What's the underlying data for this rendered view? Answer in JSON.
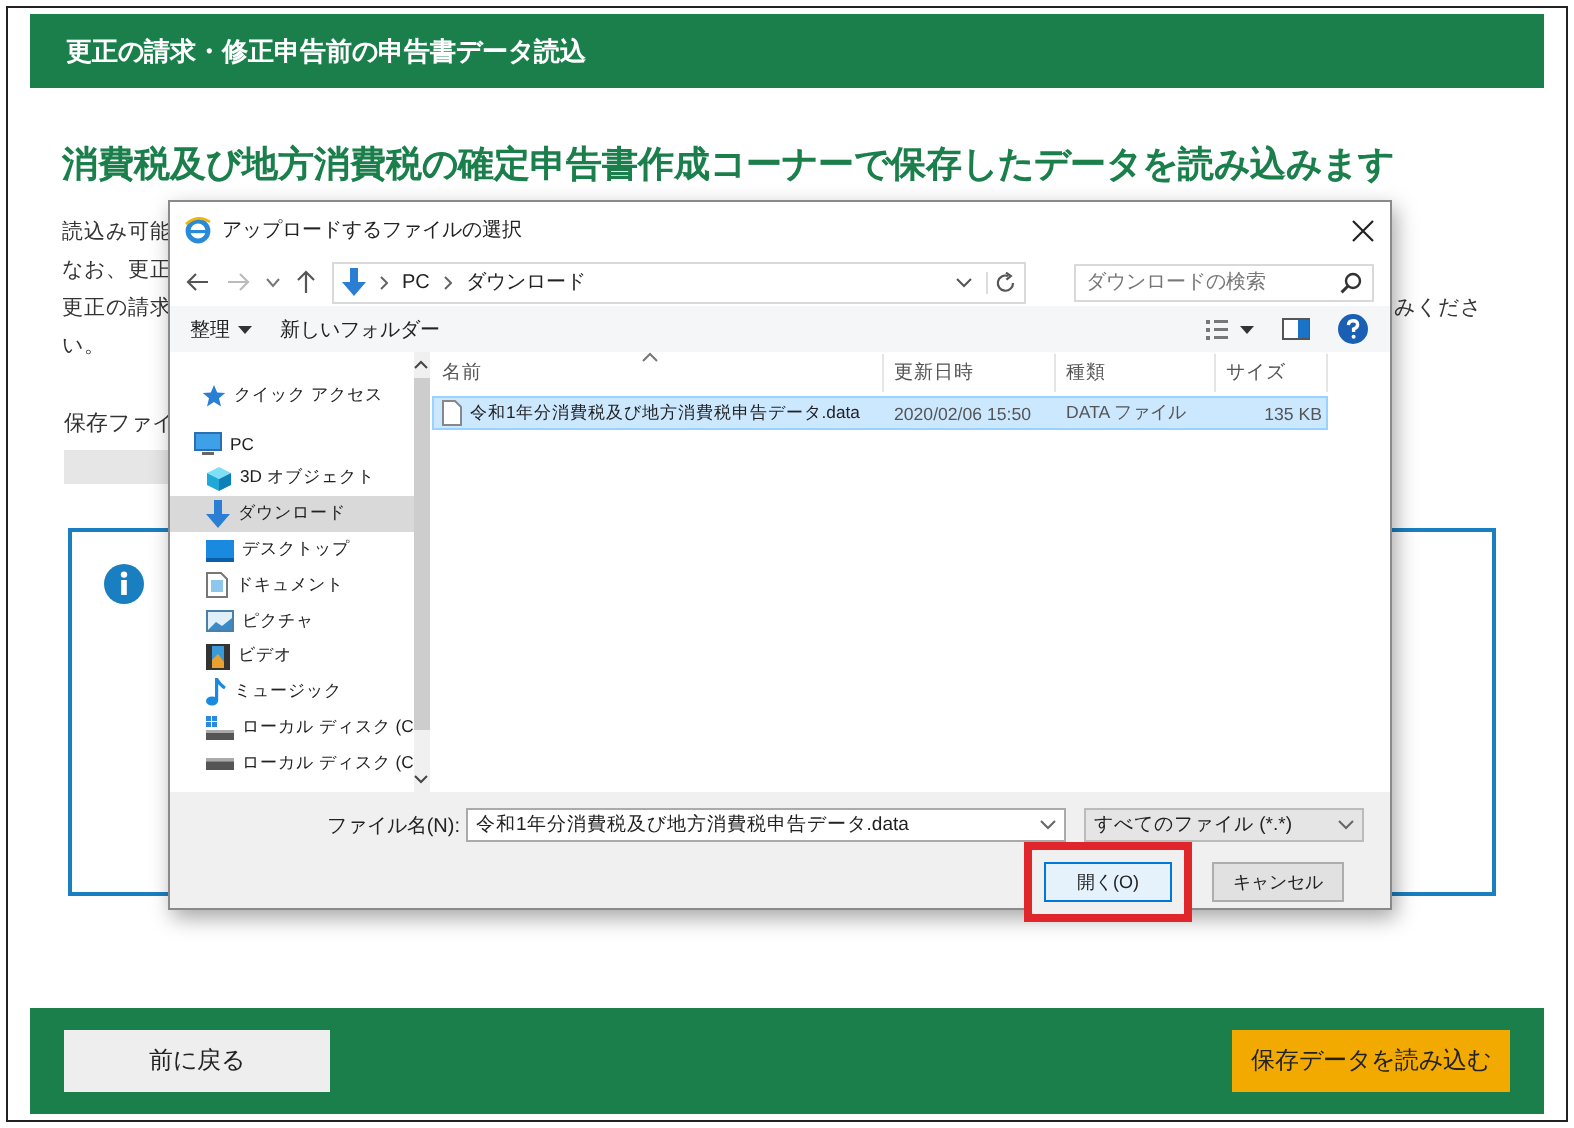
{
  "header": {
    "title": "更正の請求・修正申告前の申告書データ読込"
  },
  "page": {
    "heading": "消費税及び地方消費税の確定申告書作成コーナーで保存したデータを読み込みます",
    "lines": [
      {
        "left": "読込み可能"
      },
      {
        "left": "なお、更正"
      },
      {
        "left": "更正の請求",
        "right": "みくださ"
      },
      {
        "left": "い。"
      }
    ],
    "save_label": "保存ファイ"
  },
  "dialog": {
    "title": "アップロードするファイルの選択",
    "path": [
      "PC",
      "ダウンロード"
    ],
    "search": {
      "placeholder": "ダウンロードの検索"
    },
    "toolbar": [
      "整理",
      "新しいフォルダー"
    ],
    "nav_items": [
      {
        "label": "クイック アクセス",
        "kind": "star",
        "selected": false
      },
      {
        "label": "PC",
        "kind": "pc",
        "selected": false,
        "children": [
          {
            "label": "3D オブジェクト",
            "kind": "cube",
            "selected": false
          },
          {
            "label": "ダウンロード",
            "kind": "download",
            "selected": true
          },
          {
            "label": "デスクトップ",
            "kind": "desktop",
            "selected": false
          },
          {
            "label": "ドキュメント",
            "kind": "document",
            "selected": false
          },
          {
            "label": "ピクチャ",
            "kind": "picture",
            "selected": false
          },
          {
            "label": "ビデオ",
            "kind": "video",
            "selected": false
          },
          {
            "label": "ミュージック",
            "kind": "music",
            "selected": false
          },
          {
            "label": "ローカル ディスク (C",
            "kind": "drive_win",
            "selected": false
          },
          {
            "label": "ローカル ディスク (C",
            "kind": "drive",
            "selected": false
          }
        ]
      }
    ],
    "columns": [
      "名前",
      "更新日時",
      "種類",
      "サイズ"
    ],
    "files": [
      {
        "name": "令和1年分消費税及び地方消費税申告データ.data",
        "modified": "2020/02/06 15:50",
        "type": "DATA ファイル",
        "size": "135 KB",
        "selected": true
      }
    ],
    "filename_label": "ファイル名(N):",
    "filename_value": "令和1年分消費税及び地方消費税申告データ.data",
    "filter": "すべてのファイル (*.*)",
    "buttons": [
      {
        "label": "開く(O)",
        "default": true,
        "highlighted": true
      },
      {
        "label": "キャンセル",
        "default": false,
        "highlighted": false
      }
    ]
  },
  "footer": {
    "buttons": [
      {
        "label": "前に戻る",
        "kind": "secondary"
      },
      {
        "label": "保存データを読み込む",
        "kind": "primary"
      }
    ]
  }
}
